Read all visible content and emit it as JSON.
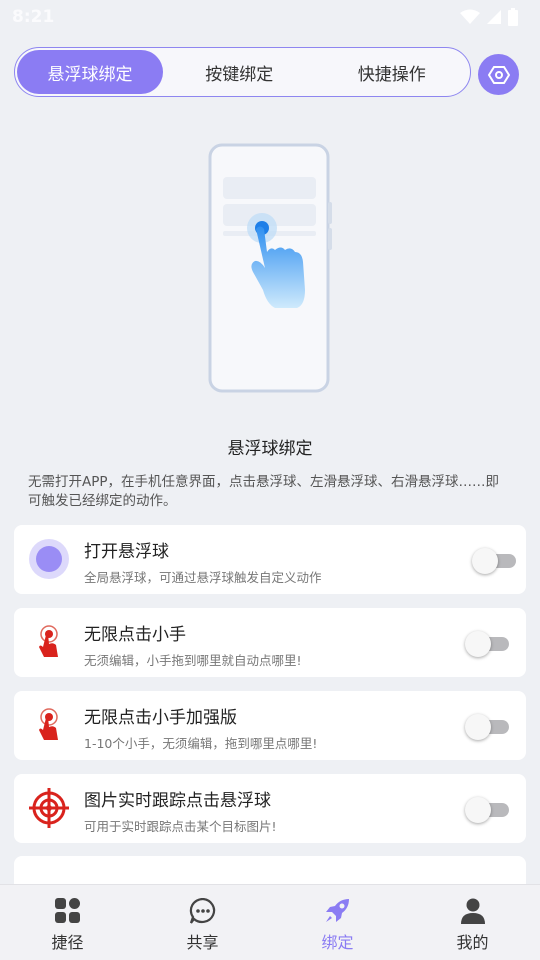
{
  "status": {
    "time": "8:21"
  },
  "tabs": [
    {
      "label": "悬浮球绑定",
      "active": true
    },
    {
      "label": "按键绑定",
      "active": false
    },
    {
      "label": "快捷操作",
      "active": false
    }
  ],
  "section": {
    "title": "悬浮球绑定",
    "description": "无需打开APP，在手机任意界面，点击悬浮球、左滑悬浮球、右滑悬浮球……即可触发已经绑定的动作。"
  },
  "items": [
    {
      "title": "打开悬浮球",
      "subtitle": "全局悬浮球，可通过悬浮球触发自定义动作",
      "icon": "floating-ball-icon",
      "enabled": false
    },
    {
      "title": "无限点击小手",
      "subtitle": "无须编辑，小手拖到哪里就自动点哪里!",
      "icon": "tap-hand-icon",
      "enabled": false
    },
    {
      "title": "无限点击小手加强版",
      "subtitle": "1-10个小手，无须编辑，拖到哪里点哪里!",
      "icon": "tap-hand-plus-icon",
      "enabled": false
    },
    {
      "title": "图片实时跟踪点击悬浮球",
      "subtitle": "可用于实时跟踪点击某个目标图片!",
      "icon": "crosshair-icon",
      "enabled": false
    }
  ],
  "nav": [
    {
      "label": "捷径",
      "icon": "grid-icon",
      "active": false
    },
    {
      "label": "共享",
      "icon": "chat-icon",
      "active": false
    },
    {
      "label": "绑定",
      "icon": "rocket-icon",
      "active": true
    },
    {
      "label": "我的",
      "icon": "user-icon",
      "active": false
    }
  ],
  "colors": {
    "accent": "#8b7cf3",
    "background": "#eef0f4",
    "red": "#d9231d"
  }
}
